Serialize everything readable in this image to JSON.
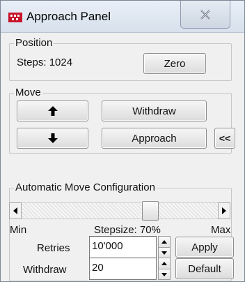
{
  "window": {
    "title": "Approach Panel",
    "icon": "red-app-icon",
    "close_icon": "close-x-icon"
  },
  "position": {
    "legend": "Position",
    "steps_text": "Steps: 1024",
    "zero_label": "Zero"
  },
  "move": {
    "legend": "Move",
    "up_icon": "arrow-up-icon",
    "down_icon": "arrow-down-icon",
    "withdraw_label": "Withdraw",
    "approach_label": "Approach",
    "collapse_label": "<<"
  },
  "config": {
    "legend": "Automatic Move Configuration",
    "slider": {
      "min_label": "Min",
      "max_label": "Max",
      "stepsize_text": "Stepsize: 70%",
      "value_percent": 70
    },
    "retries_label": "Retries",
    "retries_value": "10'000",
    "withdraw_label": "Withdraw",
    "withdraw_value": "20",
    "apply_label": "Apply",
    "default_label": "Default"
  },
  "colors": {
    "accent_icon": "#c8142a",
    "window_bg": "#f0f0f0"
  }
}
